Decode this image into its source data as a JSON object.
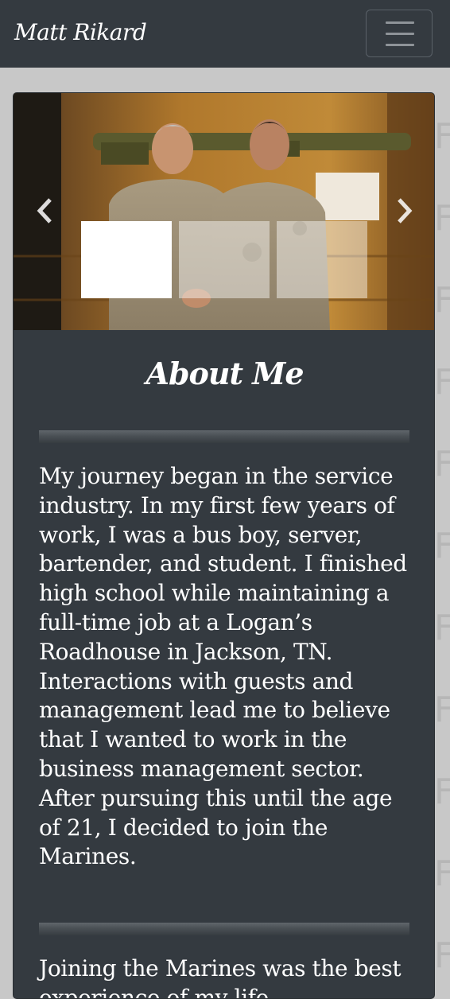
{
  "navbar": {
    "brand": "Matt Rikard",
    "toggle_icon": "hamburger-menu-icon"
  },
  "carousel": {
    "image_alt": "Two Marines in desert camouflage uniforms shaking hands in front of a wall-mounted weapon",
    "prev_icon": "chevron-left-icon",
    "next_icon": "chevron-right-icon",
    "slide_count": 3,
    "active_slide": 1
  },
  "about": {
    "title": "About Me",
    "paragraphs": [
      "My journey began in the service industry. In my first few years of work, I was a bus boy, server, bartender, and student. I finished high school while maintaining a full-time job at a Logan’s Roadhouse in Jackson, TN. Interactions with guests and management lead me to believe that I wanted to work in the business management sector. After pursuing this until the age of 21, I decided to join the Marines.",
      "Joining the Marines was the best experience of my life"
    ]
  },
  "colors": {
    "navbar_bg": "#343a40",
    "page_bg": "#c8c8c8",
    "text": "#ffffff"
  }
}
